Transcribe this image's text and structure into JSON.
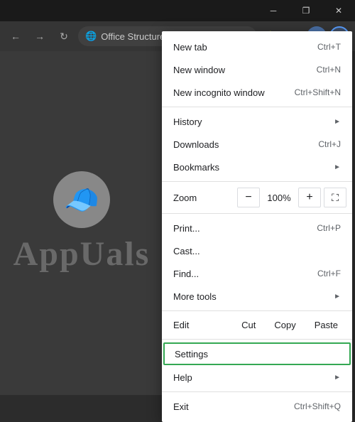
{
  "titlebar": {
    "minimize_label": "─",
    "maximize_label": "❐",
    "close_label": "✕"
  },
  "toolbar": {
    "address": "Office Structure C...",
    "tab_label": "Office Structure C..."
  },
  "watermark": {
    "text": "AppUals",
    "emoji": "🧢"
  },
  "menu": {
    "items": [
      {
        "label": "New tab",
        "shortcut": "Ctrl+T",
        "hasArrow": false
      },
      {
        "label": "New window",
        "shortcut": "Ctrl+N",
        "hasArrow": false
      },
      {
        "label": "New incognito window",
        "shortcut": "Ctrl+Shift+N",
        "hasArrow": false
      }
    ],
    "history": "History",
    "downloads": "Downloads",
    "downloads_shortcut": "Ctrl+J",
    "bookmarks": "Bookmarks",
    "zoom_label": "Zoom",
    "zoom_value": "100%",
    "zoom_minus": "−",
    "zoom_plus": "+",
    "print": "Print...",
    "print_shortcut": "Ctrl+P",
    "cast": "Cast...",
    "find": "Find...",
    "find_shortcut": "Ctrl+F",
    "more_tools": "More tools",
    "edit_label": "Edit",
    "cut_label": "Cut",
    "copy_label": "Copy",
    "paste_label": "Paste",
    "settings_label": "Settings",
    "help_label": "Help",
    "exit_label": "Exit",
    "exit_shortcut": "Ctrl+Shift+Q"
  }
}
